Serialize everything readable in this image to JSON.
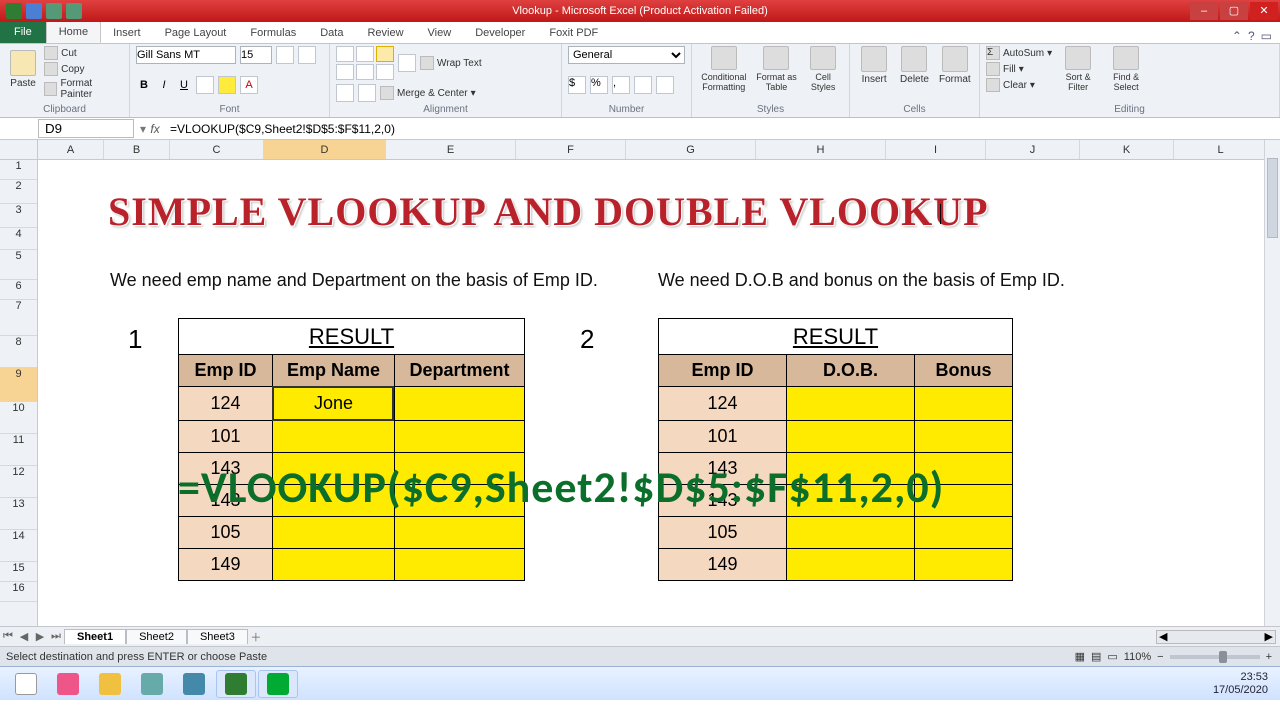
{
  "app": {
    "title": "Vlookup - Microsoft Excel (Product Activation Failed)"
  },
  "tabs": {
    "file": "File",
    "home": "Home",
    "insert": "Insert",
    "page": "Page Layout",
    "formulas": "Formulas",
    "data": "Data",
    "review": "Review",
    "view": "View",
    "developer": "Developer",
    "foxit": "Foxit PDF"
  },
  "ribbon": {
    "clipboard": {
      "label": "Clipboard",
      "paste": "Paste",
      "cut": "Cut",
      "copy": "Copy",
      "fmt": "Format Painter"
    },
    "font": {
      "label": "Font",
      "family": "Gill Sans MT",
      "size": "15"
    },
    "alignment": {
      "label": "Alignment",
      "wrap": "Wrap Text",
      "merge": "Merge & Center"
    },
    "number": {
      "label": "Number",
      "format": "General"
    },
    "styles": {
      "label": "Styles",
      "cond": "Conditional Formatting",
      "fat": "Format as Table",
      "cstyle": "Cell Styles"
    },
    "cells": {
      "label": "Cells",
      "insert": "Insert",
      "delete": "Delete",
      "format": "Format"
    },
    "editing": {
      "label": "Editing",
      "sum": "AutoSum",
      "fill": "Fill",
      "clear": "Clear",
      "sort": "Sort & Filter",
      "find": "Find & Select"
    }
  },
  "fbar": {
    "name": "D9",
    "formula": "=VLOOKUP($C9,Sheet2!$D$5:$F$11,2,0)"
  },
  "columns": [
    "A",
    "B",
    "C",
    "D",
    "E",
    "F",
    "G",
    "H",
    "I",
    "J",
    "K",
    "L"
  ],
  "rows": [
    "1",
    "2",
    "3",
    "4",
    "5",
    "6",
    "7",
    "8",
    "9",
    "10",
    "11",
    "12",
    "13",
    "14",
    "15",
    "16"
  ],
  "title_text": "SIMPLE VLOOKUP AND DOUBLE VLOOKUP",
  "intro1": "We need emp name and Department on the basis of Emp ID.",
  "intro2": "We need D.O.B and bonus on the basis of Emp ID.",
  "tbl1": {
    "num": "1",
    "result": "RESULT",
    "headers": [
      "Emp ID",
      "Emp Name",
      "Department"
    ],
    "ids": [
      "124",
      "101",
      "143",
      "143",
      "105",
      "149"
    ],
    "d9": "Jone"
  },
  "tbl2": {
    "num": "2",
    "result": "RESULT",
    "headers": [
      "Emp ID",
      "D.O.B.",
      "Bonus"
    ],
    "ids": [
      "124",
      "101",
      "143",
      "143",
      "105",
      "149"
    ]
  },
  "overlay_formula": "=VLOOKUP($C9,Sheet2!$D$5:$F$11,2,0)",
  "sheets": {
    "s1": "Sheet1",
    "s2": "Sheet2",
    "s3": "Sheet3"
  },
  "status": {
    "msg": "Select destination and press ENTER or choose Paste",
    "zoom": "110%"
  },
  "clock": {
    "time": "23:53",
    "date": "17/05/2020"
  },
  "chart_data": null
}
